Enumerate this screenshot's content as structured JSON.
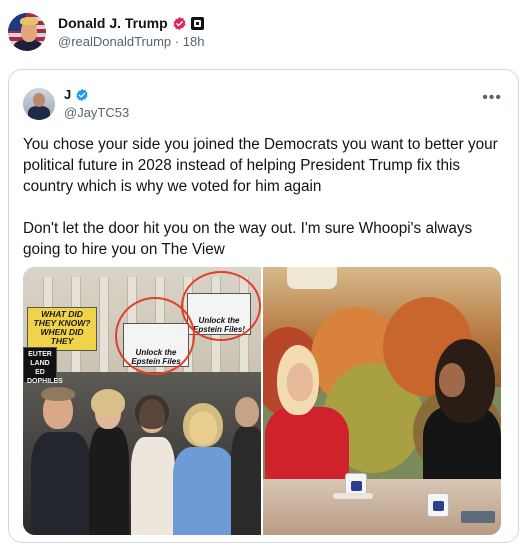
{
  "post": {
    "author_name": "Donald J. Trump",
    "author_handle": "@realDonaldTrump",
    "time_separator": "·",
    "time_ago": "18h",
    "verified_badge_icon": "verified-badge-icon",
    "affiliate_badge_icon": "affiliate-badge-icon",
    "badge_color": "#e0245e"
  },
  "quoted_post": {
    "author_name": "J",
    "author_handle": "@JayTC53",
    "verified_color": "#1d9bf0",
    "more_icon": "more-icon",
    "paragraphs": [
      "You chose your side you joined the Democrats you want to better your political future in 2028 instead of helping President Trump fix this country which is why we voted for him again",
      "Don't let the door hit you on the way out. I'm sure Whoopi's always going to hire you on The View"
    ],
    "media": {
      "left_signs": {
        "sign1": "WHAT DID THEY KNOW? WHEN DID THEY",
        "sign2": "Unlock the Epstein Files!",
        "sign3": "Unlock the Epstein Files",
        "sign4": "EUTER LAND ED DOPHILES"
      }
    }
  }
}
